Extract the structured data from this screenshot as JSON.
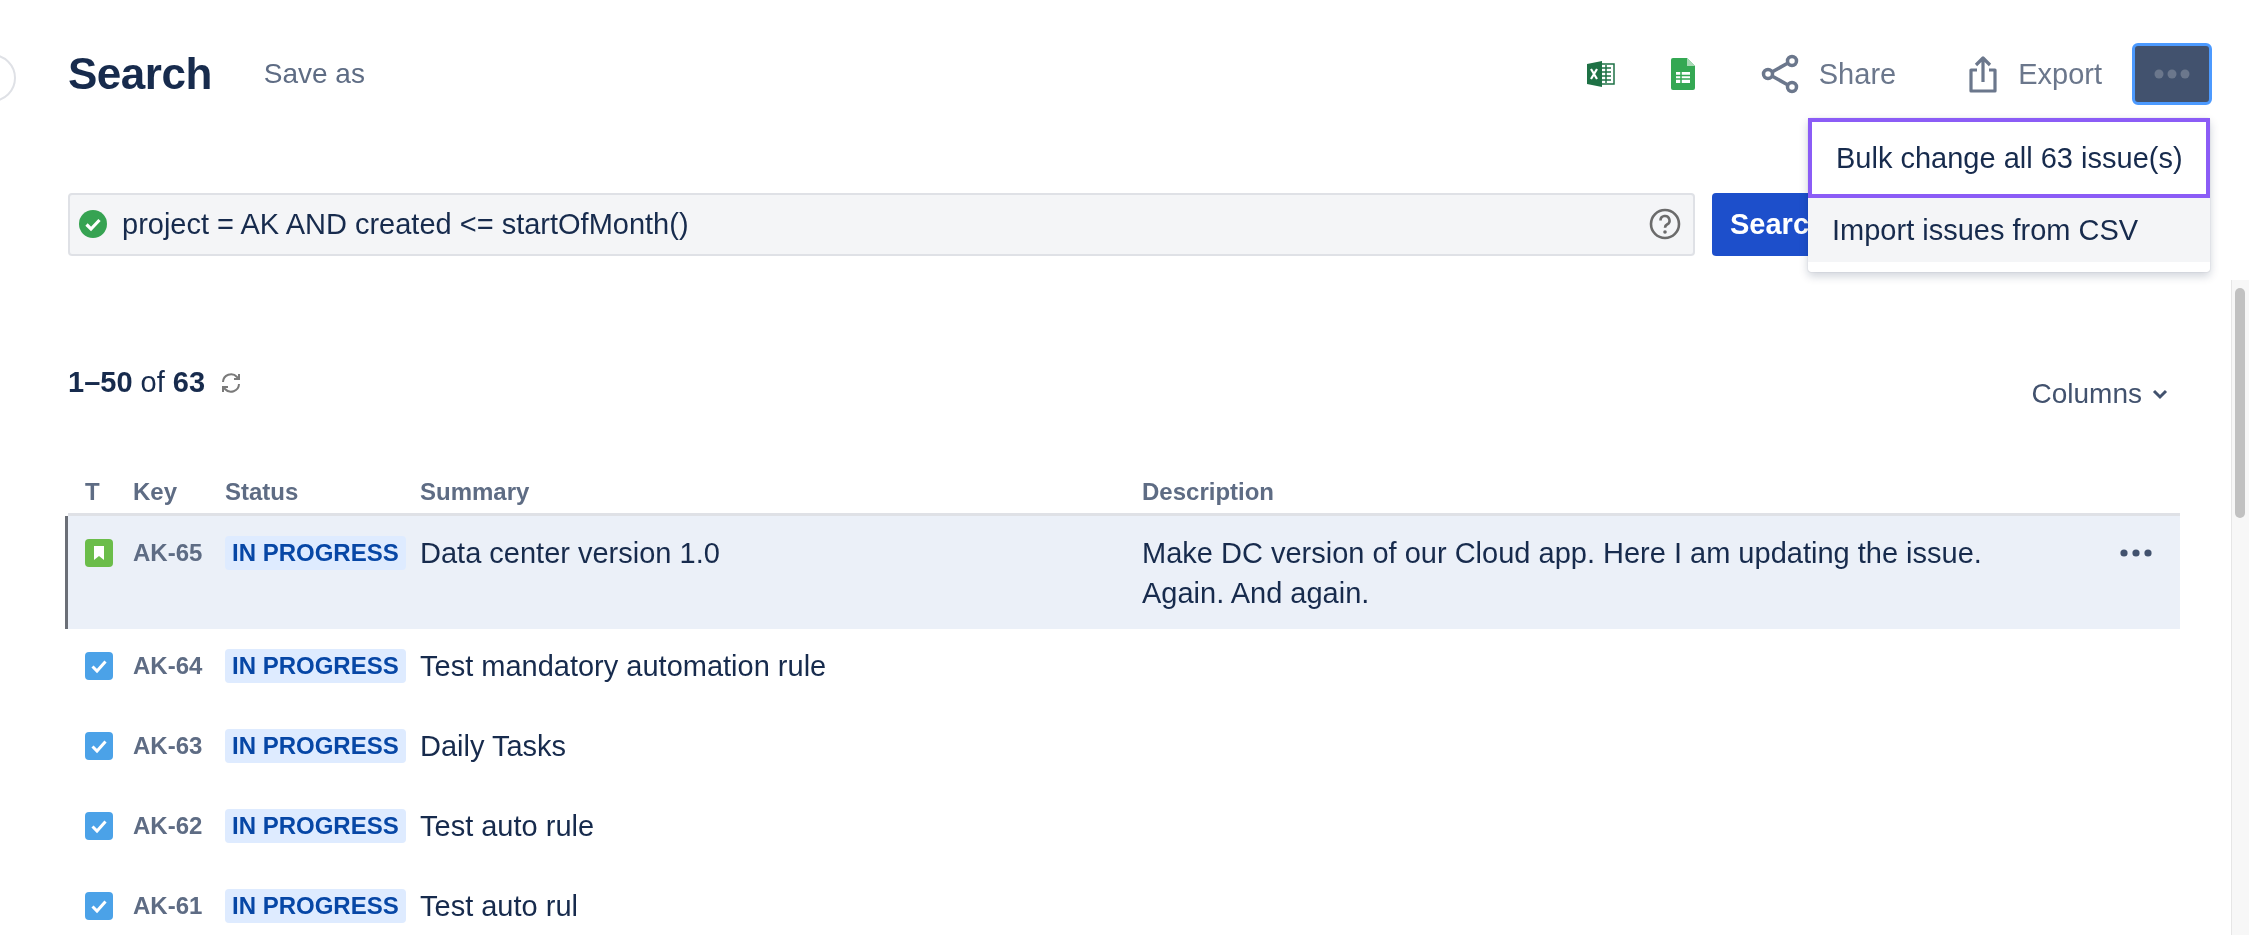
{
  "header": {
    "title": "Search",
    "save_as": "Save as"
  },
  "toolbar": [
    {
      "kind": "excel"
    },
    {
      "kind": "sheets"
    },
    {
      "kind": "share",
      "label": "Share"
    },
    {
      "kind": "export",
      "label": "Export"
    },
    {
      "kind": "more",
      "expanded": true
    }
  ],
  "menu": {
    "items": [
      {
        "label": "Bulk change all 63 issue(s)",
        "selected": true
      },
      {
        "label": "Import issues from CSV",
        "selected": false
      }
    ]
  },
  "query": {
    "value": "project = AK AND created <= startOfMonth()",
    "valid": true,
    "button": "Searc"
  },
  "results": {
    "count": "**1–50** of **63**",
    "columns_button": "Columns"
  },
  "table": {
    "columns": [
      "T",
      "Key",
      "Status",
      "Summary",
      "Description"
    ],
    "rows": [
      {
        "kind": "story",
        "key": "AK-65",
        "status": "IN PROGRESS",
        "summary": "Data center version 1.0",
        "description": "Make DC version of our Cloud app. Here I am updating the issue. Again. And again.",
        "selected": true
      },
      {
        "kind": "task",
        "key": "AK-64",
        "status": "IN PROGRESS",
        "summary": "Test mandatory automation rule",
        "selected": false
      },
      {
        "kind": "task",
        "key": "AK-63",
        "status": "IN PROGRESS",
        "summary": "Daily Tasks",
        "selected": false
      },
      {
        "kind": "task",
        "key": "AK-62",
        "status": "IN PROGRESS",
        "summary": "Test auto rule",
        "selected": false
      },
      {
        "kind": "task",
        "key": "AK-61",
        "status": "IN PROGRESS",
        "summary": "Test auto rul",
        "selected": false
      }
    ]
  }
}
